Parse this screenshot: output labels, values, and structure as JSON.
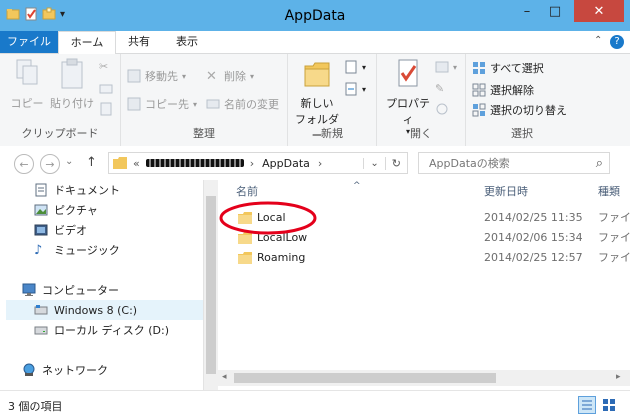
{
  "window": {
    "title": "AppData",
    "min_glyph": "–",
    "max_glyph": "□",
    "close_glyph": "✕"
  },
  "qat": {
    "dropdown_glyph": "▾"
  },
  "ribbon_tabs": {
    "file": "ファイル",
    "home": "ホーム",
    "share": "共有",
    "view": "表示",
    "collapse_glyph": "⌃",
    "help_glyph": "?"
  },
  "ribbon": {
    "clipboard": {
      "label": "クリップボード",
      "copy": "コピー",
      "paste": "貼り付け"
    },
    "organize": {
      "label": "整理",
      "move_to": "移動先",
      "copy_to": "コピー先",
      "delete": "削除",
      "rename": "名前の変更"
    },
    "new": {
      "label": "新規",
      "new_folder_line1": "新しい",
      "new_folder_line2": "フォルダー"
    },
    "open": {
      "label": "開く",
      "properties": "プロパティ"
    },
    "select": {
      "label": "選択",
      "select_all": "すべて選択",
      "select_none": "選択解除",
      "invert": "選択の切り替え"
    }
  },
  "nav": {
    "back": "←",
    "forward": "→",
    "history_glyph": "⌄",
    "up": "↑",
    "address_prefix": "«",
    "address_current": "AppData",
    "address_sep": "›",
    "address_dropdown": "⌄",
    "refresh": "↻",
    "search_placeholder": "AppDataの検索",
    "search_icon_glyph": "⌕"
  },
  "sidebar": {
    "documents": "ドキュメント",
    "pictures": "ピクチャ",
    "videos": "ビデオ",
    "music": "ミュージック",
    "computer": "コンピューター",
    "drive_c": "Windows 8 (C:)",
    "drive_d": "ローカル ディスク (D:)",
    "network": "ネットワーク"
  },
  "columns": {
    "name": "名前",
    "modified": "更新日時",
    "type": "種類",
    "sort_glyph": "^"
  },
  "files": [
    {
      "name": "Local",
      "modified": "2014/02/25 11:35",
      "type": "ファイ"
    },
    {
      "name": "LocalLow",
      "modified": "2014/02/06 15:34",
      "type": "ファイ"
    },
    {
      "name": "Roaming",
      "modified": "2014/02/25 12:57",
      "type": "ファイ"
    }
  ],
  "status": {
    "count": "3 個の項目"
  },
  "colors": {
    "title_bar": "#5db2e8",
    "file_tab": "#1979ca",
    "close": "#c7483f",
    "folder": "#f2c75c",
    "highlight": "#e4001b"
  }
}
